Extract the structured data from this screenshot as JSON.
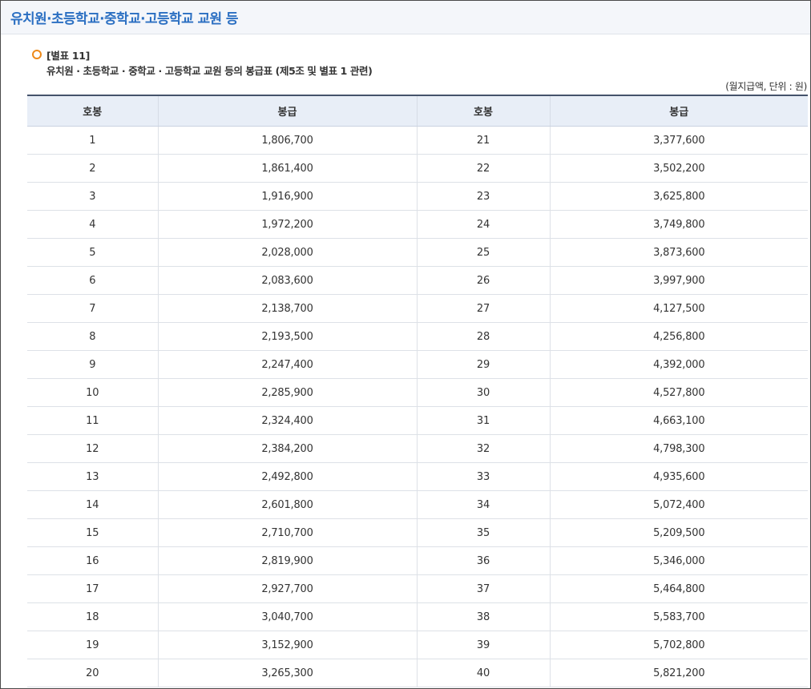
{
  "header": {
    "title": "유치원·초등학교·중학교·고등학교 교원 등"
  },
  "note": {
    "label": "[별표 11]",
    "description": "유치원 · 초등학교 · 중학교 · 고등학교 교원 등의 봉급표 (제5조 및 별표 1 관련)",
    "unit": "(월지급액, 단위 : 원)"
  },
  "table": {
    "headers": [
      "호봉",
      "봉급",
      "호봉",
      "봉급"
    ],
    "rows": [
      [
        "1",
        "1,806,700",
        "21",
        "3,377,600"
      ],
      [
        "2",
        "1,861,400",
        "22",
        "3,502,200"
      ],
      [
        "3",
        "1,916,900",
        "23",
        "3,625,800"
      ],
      [
        "4",
        "1,972,200",
        "24",
        "3,749,800"
      ],
      [
        "5",
        "2,028,000",
        "25",
        "3,873,600"
      ],
      [
        "6",
        "2,083,600",
        "26",
        "3,997,900"
      ],
      [
        "7",
        "2,138,700",
        "27",
        "4,127,500"
      ],
      [
        "8",
        "2,193,500",
        "28",
        "4,256,800"
      ],
      [
        "9",
        "2,247,400",
        "29",
        "4,392,000"
      ],
      [
        "10",
        "2,285,900",
        "30",
        "4,527,800"
      ],
      [
        "11",
        "2,324,400",
        "31",
        "4,663,100"
      ],
      [
        "12",
        "2,384,200",
        "32",
        "4,798,300"
      ],
      [
        "13",
        "2,492,800",
        "33",
        "4,935,600"
      ],
      [
        "14",
        "2,601,800",
        "34",
        "5,072,400"
      ],
      [
        "15",
        "2,710,700",
        "35",
        "5,209,500"
      ],
      [
        "16",
        "2,819,900",
        "36",
        "5,346,000"
      ],
      [
        "17",
        "2,927,700",
        "37",
        "5,464,800"
      ],
      [
        "18",
        "3,040,700",
        "38",
        "5,583,700"
      ],
      [
        "19",
        "3,152,900",
        "39",
        "5,702,800"
      ],
      [
        "20",
        "3,265,300",
        "40",
        "5,821,200"
      ]
    ]
  },
  "colors": {
    "title": "#2b6fc2",
    "bullet": "#ee8a1b",
    "header_bg": "#e8eef7",
    "table_top_border": "#45536b"
  },
  "icons": {
    "bullet": "circle-bullet-icon"
  }
}
